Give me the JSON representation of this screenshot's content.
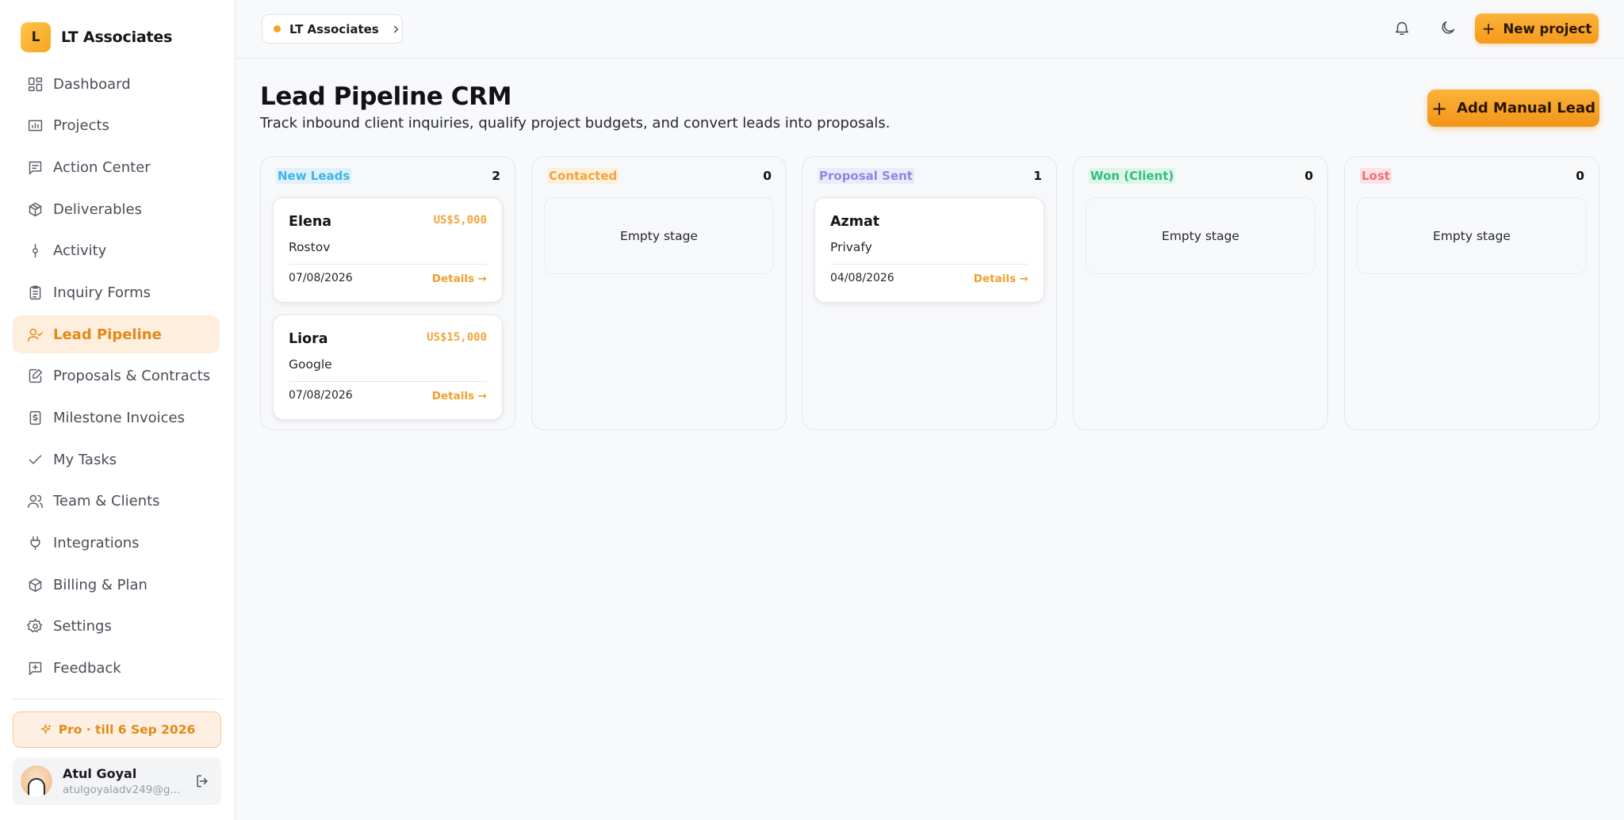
{
  "brand": {
    "logo_letter": "L",
    "name": "LT Associates"
  },
  "sidebar": {
    "items": [
      {
        "label": "Dashboard",
        "icon": "dashboard-icon"
      },
      {
        "label": "Projects",
        "icon": "projects-icon"
      },
      {
        "label": "Action Center",
        "icon": "action-center-icon"
      },
      {
        "label": "Deliverables",
        "icon": "package-icon"
      },
      {
        "label": "Activity",
        "icon": "activity-icon"
      },
      {
        "label": "Inquiry Forms",
        "icon": "clipboard-icon"
      },
      {
        "label": "Lead Pipeline",
        "icon": "user-check-icon"
      },
      {
        "label": "Proposals & Contracts",
        "icon": "file-edit-icon"
      },
      {
        "label": "Milestone Invoices",
        "icon": "invoice-dollar-icon"
      },
      {
        "label": "My Tasks",
        "icon": "check-icon"
      },
      {
        "label": "Team & Clients",
        "icon": "users-icon"
      },
      {
        "label": "Integrations",
        "icon": "plug-icon"
      },
      {
        "label": "Billing & Plan",
        "icon": "billing-package-icon"
      },
      {
        "label": "Settings",
        "icon": "gear-icon"
      },
      {
        "label": "Feedback",
        "icon": "feedback-icon"
      }
    ],
    "active": "Lead Pipeline",
    "plan_badge": "Pro · till 6 Sep 2026",
    "user": {
      "name": "Atul Goyal",
      "email": "atulgoyaladv249@g..."
    }
  },
  "topbar": {
    "workspace": "LT Associates",
    "new_project_label": "New project"
  },
  "page": {
    "title": "Lead Pipeline CRM",
    "subtitle": "Track inbound client inquiries, qualify project budgets, and convert leads into proposals.",
    "add_lead_label": "Add Manual Lead"
  },
  "empty_label": "Empty stage",
  "details_label": "Details →",
  "columns": [
    {
      "title": "New Leads",
      "count": "2",
      "color": "#3fb4e8",
      "bg": "#dff1fb",
      "cards": [
        {
          "name": "Elena",
          "budget": "US$5,000",
          "company": "Rostov",
          "date": "07/08/2026"
        },
        {
          "name": "Liora",
          "budget": "US$15,000",
          "company": "Google",
          "date": "07/08/2026"
        }
      ]
    },
    {
      "title": "Contacted",
      "count": "0",
      "color": "#f0a53c",
      "bg": "#fdf0dd",
      "cards": []
    },
    {
      "title": "Proposal Sent",
      "count": "1",
      "color": "#8c89e0",
      "bg": "#ecebfb",
      "cards": [
        {
          "name": "Azmat",
          "budget": "",
          "company": "Privafy",
          "date": "04/08/2026"
        }
      ]
    },
    {
      "title": "Won (Client)",
      "count": "0",
      "color": "#2fbf7c",
      "bg": "#def6ea",
      "cards": []
    },
    {
      "title": "Lost",
      "count": "0",
      "color": "#f07079",
      "bg": "#fde3e5",
      "cards": []
    }
  ],
  "colors": {
    "accent": "#f5a623",
    "accent_text": "#e28a17"
  }
}
